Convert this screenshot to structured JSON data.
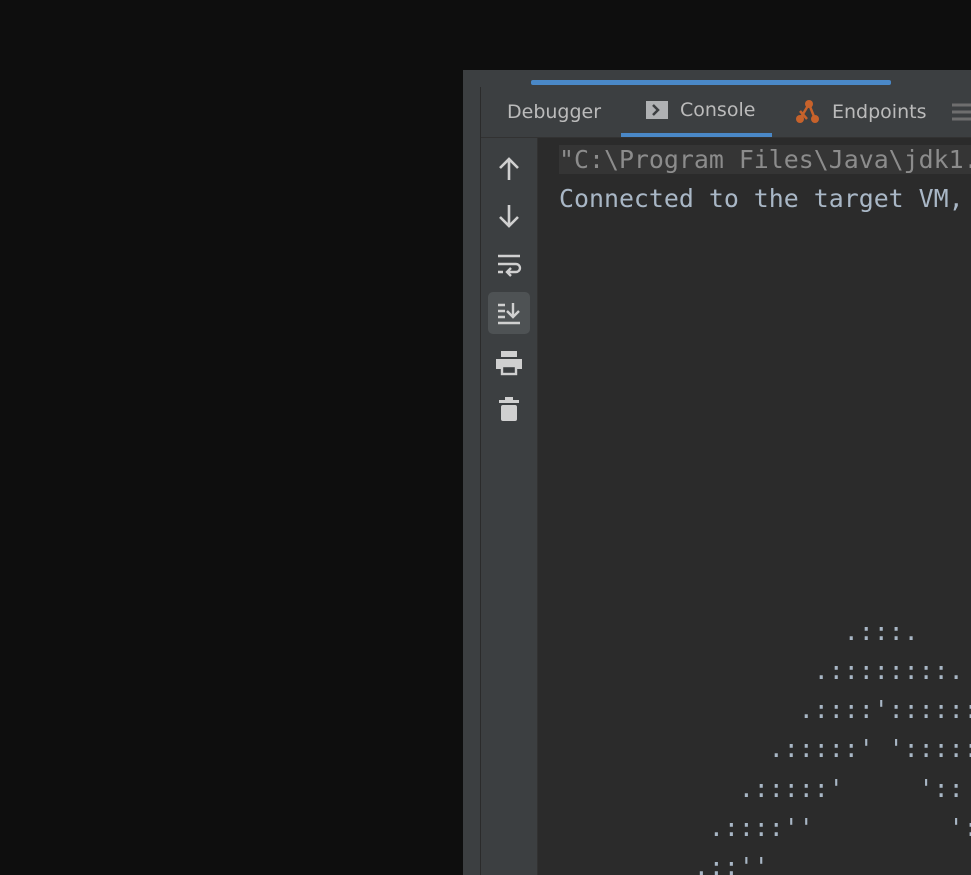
{
  "tabs": [
    {
      "label": "Debugger",
      "icon": "none",
      "active": false
    },
    {
      "label": "Console",
      "icon": "console-icon",
      "active": true
    },
    {
      "label": "Endpoints",
      "icon": "endpoints-icon",
      "active": false
    }
  ],
  "toolbar": [
    "scroll-up-icon",
    "scroll-down-icon",
    "soft-wrap-icon",
    "scroll-to-end-icon",
    "print-icon",
    "clear-all-icon"
  ],
  "console": {
    "lines": [
      "\"C:\\Program Files\\Java\\jdk1.",
      "Connected to the target VM,",
      "",
      "",
      "",
      "",
      "",
      "",
      "",
      "",
      "",
      "",
      "                   .:::.",
      "                 .::::::::.",
      "                .::::'::::::",
      "              .:::::' '::::::",
      "            .:::::'     '::",
      "          .::::''         ':",
      "         .::''"
    ]
  },
  "colors": {
    "accent": "#4a88c7",
    "endpoints": "#c7622b",
    "text": "#a9b7c6"
  }
}
